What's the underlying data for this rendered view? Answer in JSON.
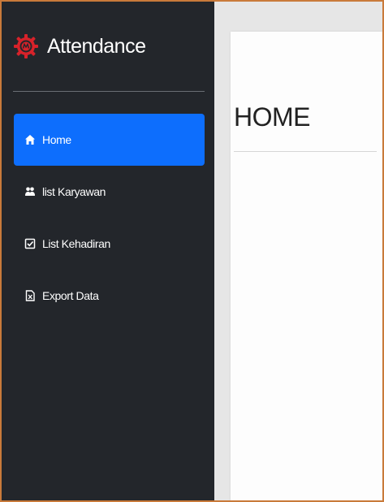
{
  "app": {
    "title": "Attendance",
    "logo_icon": "gear-logo-icon",
    "logo_color": "#d7222a"
  },
  "sidebar": {
    "background": "#23262b",
    "active_color": "#0d6efd",
    "items": [
      {
        "label": "Home",
        "icon": "home-icon",
        "active": true
      },
      {
        "label": "list Karyawan",
        "icon": "users-icon",
        "active": false
      },
      {
        "label": "List Kehadiran",
        "icon": "checkbox-icon",
        "active": false
      },
      {
        "label": "Export Data",
        "icon": "file-export-icon",
        "active": false
      }
    ]
  },
  "main": {
    "page_title": "HOME"
  }
}
